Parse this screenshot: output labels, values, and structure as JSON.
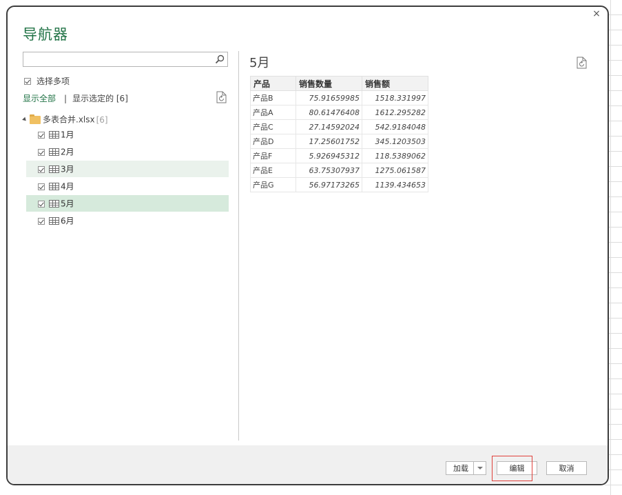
{
  "dialog": {
    "title": "导航器",
    "close_glyph": "×"
  },
  "left_pane": {
    "search": {
      "value": "",
      "placeholder": ""
    },
    "multi_select": {
      "label": "选择多项",
      "checked": true
    },
    "show_all_label": "显示全部",
    "separator": "|",
    "show_selected_label": "显示选定的 [6]",
    "tree": {
      "root": {
        "name": "多表合并.xlsx",
        "count": "[6]"
      },
      "items": [
        {
          "name": "1月",
          "checked": true
        },
        {
          "name": "2月",
          "checked": true
        },
        {
          "name": "3月",
          "checked": true
        },
        {
          "name": "4月",
          "checked": true
        },
        {
          "name": "5月",
          "checked": true
        },
        {
          "name": "6月",
          "checked": true
        }
      ]
    }
  },
  "preview": {
    "title": "5月",
    "columns": [
      "产品",
      "销售数量",
      "销售额"
    ],
    "rows": [
      [
        "产品B",
        "75.91659985",
        "1518.331997"
      ],
      [
        "产品A",
        "80.61476408",
        "1612.295282"
      ],
      [
        "产品C",
        "27.14592024",
        "542.9184048"
      ],
      [
        "产品D",
        "17.25601752",
        "345.1203503"
      ],
      [
        "产品F",
        "5.926945312",
        "118.5389062"
      ],
      [
        "产品E",
        "63.75307937",
        "1275.061587"
      ],
      [
        "产品G",
        "56.97173265",
        "1139.434653"
      ]
    ]
  },
  "footer": {
    "load_label": "加载",
    "edit_label": "编辑",
    "cancel_label": "取消"
  }
}
